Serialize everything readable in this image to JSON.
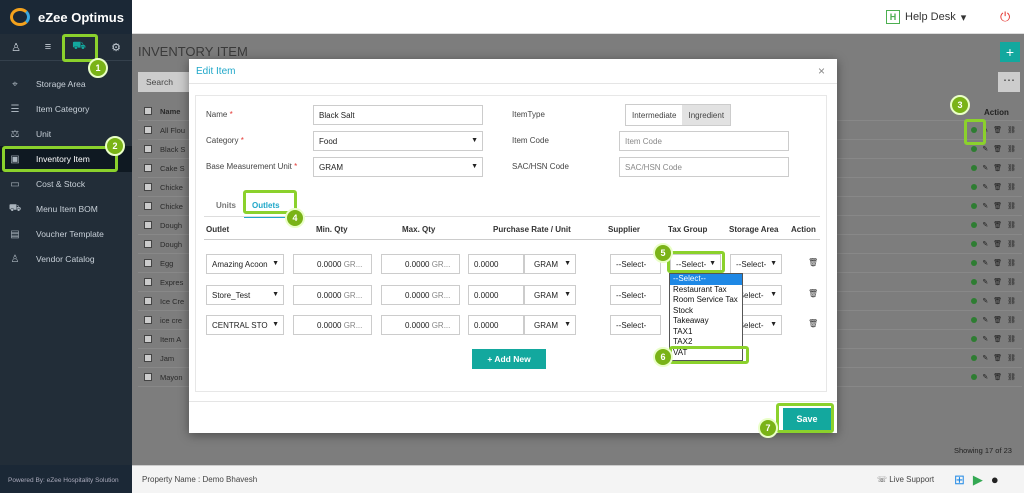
{
  "app": {
    "logo": "eZee Optimus",
    "help_desk": "Help Desk",
    "help_badge": "H"
  },
  "sidebar": {
    "items": [
      {
        "label": "Storage Area",
        "icon": "pin-icon"
      },
      {
        "label": "Item Category",
        "icon": "list-icon"
      },
      {
        "label": "Unit",
        "icon": "scale-icon"
      },
      {
        "label": "Inventory Item",
        "icon": "box-icon"
      },
      {
        "label": "Cost & Stock",
        "icon": "money-icon"
      },
      {
        "label": "Menu Item BOM",
        "icon": "cart-icon"
      },
      {
        "label": "Voucher Template",
        "icon": "ticket-icon"
      },
      {
        "label": "Vendor Catalog",
        "icon": "user-icon"
      }
    ],
    "footer": "Powered By: eZee Hospitality Solution"
  },
  "page": {
    "title": "INVENTORY ITEM",
    "search": "Search",
    "name_header": "Name",
    "action_header": "Action",
    "showing": "Showing 17 of 23",
    "rows": [
      "All Flou",
      "Black S",
      "Cake S",
      "Chicke",
      "Chicke",
      "Dough",
      "Dough",
      "Egg",
      "Expres",
      "Ice Cre",
      "ice cre",
      "Item A",
      "Jam",
      "Mayon"
    ]
  },
  "bottom": {
    "property": "Property Name : Demo Bhavesh",
    "live_support": "Live Support"
  },
  "modal": {
    "title": "Edit Item",
    "close": "×",
    "form": {
      "name_label": "Name",
      "name_value": "Black Salt",
      "category_label": "Category",
      "category_value": "Food",
      "unit_label": "Base Measurement Unit",
      "unit_value": "GRAM",
      "itemtype_label": "ItemType",
      "itemtype_options": [
        "Intermediate",
        "Ingredient"
      ],
      "itemcode_label": "Item Code",
      "itemcode_placeholder": "Item Code",
      "sac_label": "SAC/HSN Code",
      "sac_placeholder": "SAC/HSN Code",
      "required": "*"
    },
    "tabs": [
      "Units",
      "Outlets"
    ],
    "table": {
      "headers": [
        "Outlet",
        "Min. Qty",
        "Max. Qty",
        "Purchase Rate / Unit",
        "Supplier",
        "Tax Group",
        "Storage Area",
        "Action"
      ],
      "rows": [
        {
          "outlet": "Amazing Acoon",
          "min": "0.0000",
          "min_unit": "GR...",
          "max": "0.0000",
          "max_unit": "GR...",
          "rate": "0.0000",
          "rate_unit": "GRAM",
          "supplier": "--Select-",
          "tax": "--Select-",
          "storage": "--Select-"
        },
        {
          "outlet": "Store_Test",
          "min": "0.0000",
          "min_unit": "GR...",
          "max": "0.0000",
          "max_unit": "GR...",
          "rate": "0.0000",
          "rate_unit": "GRAM",
          "supplier": "--Select-",
          "tax": "",
          "storage": "-Select-"
        },
        {
          "outlet": "CENTRAL STO",
          "min": "0.0000",
          "min_unit": "GR...",
          "max": "0.0000",
          "max_unit": "GR...",
          "rate": "0.0000",
          "rate_unit": "GRAM",
          "supplier": "--Select-",
          "tax": "",
          "storage": "-Select-"
        }
      ]
    },
    "add_new": "+ Add New",
    "save": "Save",
    "tax_dropdown": [
      "--Select--",
      "Restaurant Tax",
      "Room Service Tax",
      "Stock",
      "Takeaway",
      "TAX1",
      "TAX2",
      "VAT"
    ]
  },
  "steps": [
    "1",
    "2",
    "3",
    "4",
    "5",
    "6",
    "7"
  ],
  "colors": {
    "accent": "#13a89e",
    "highlight": "#8bd12c",
    "link": "#1fa7c9"
  }
}
